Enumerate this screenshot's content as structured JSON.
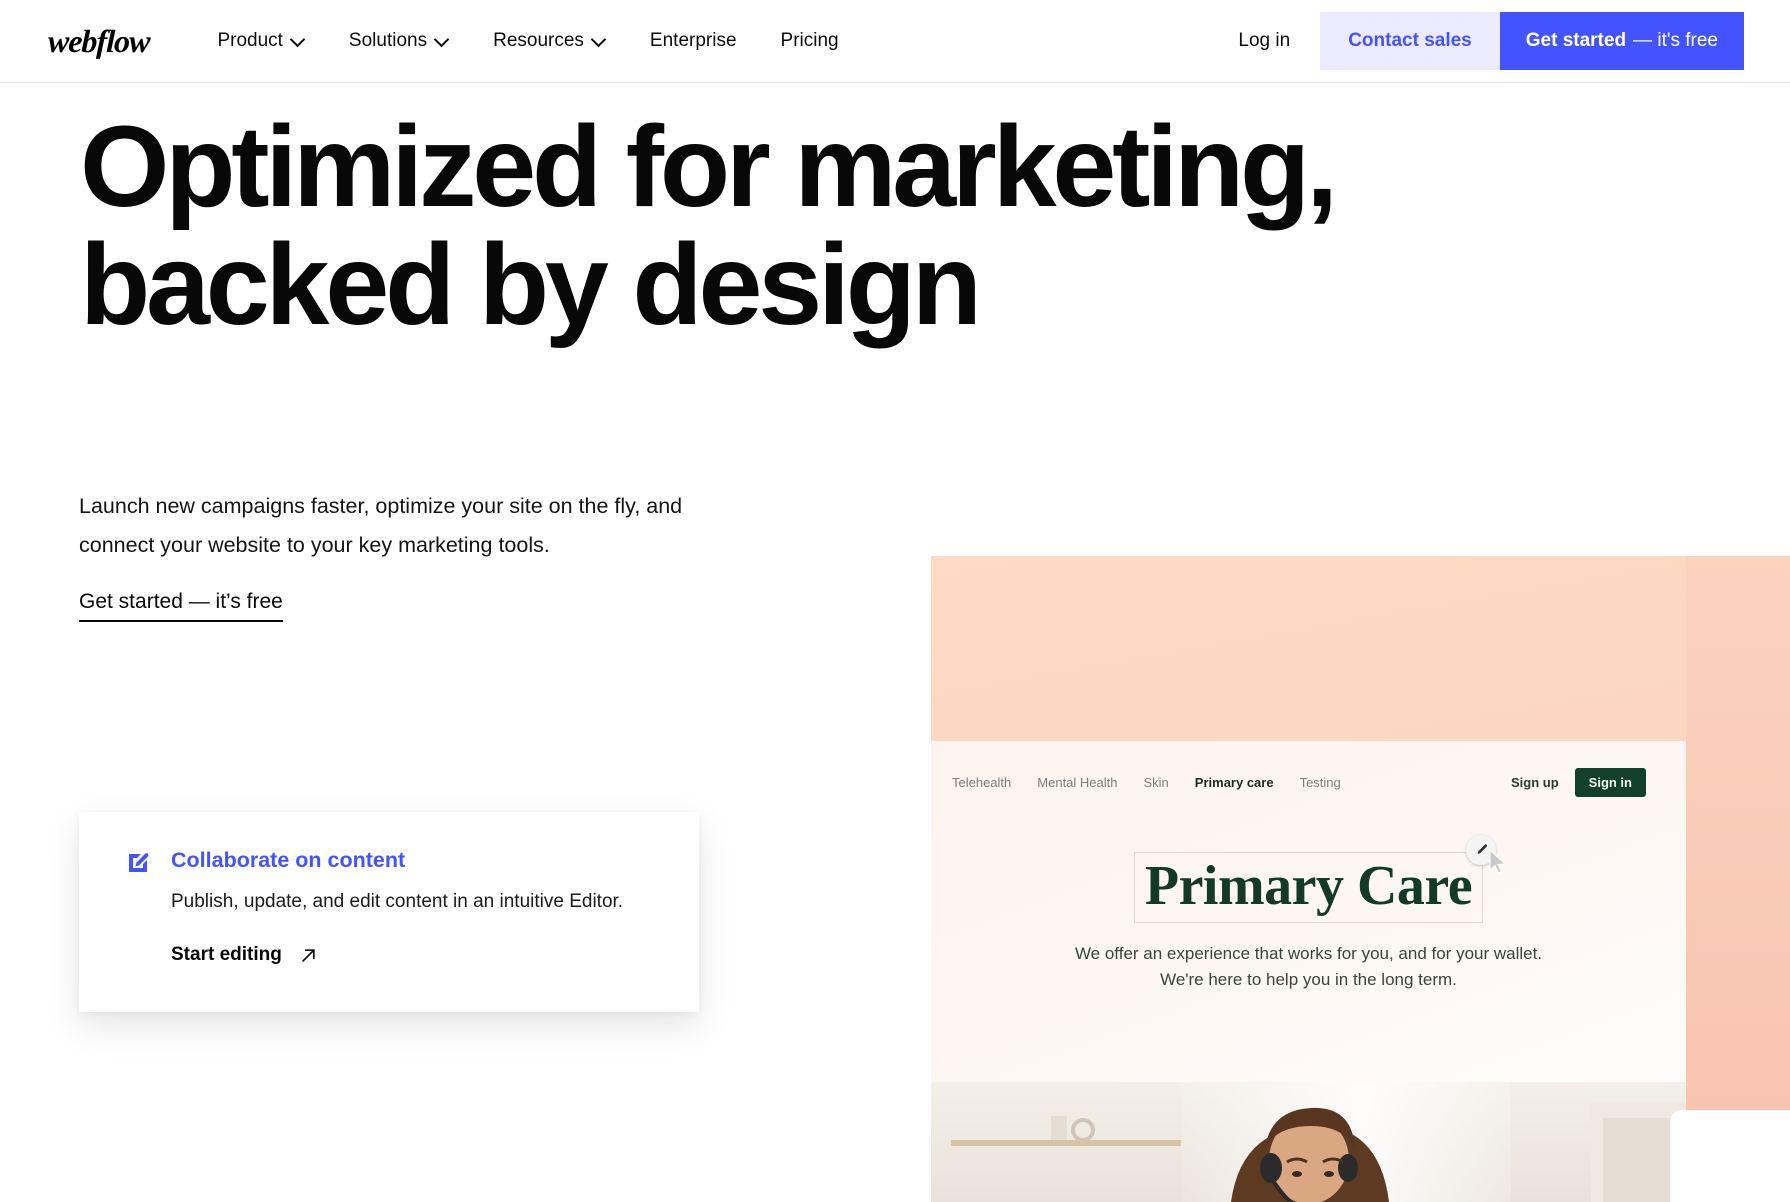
{
  "brand": {
    "name": "webflow"
  },
  "topnav": {
    "items": [
      {
        "label": "Product",
        "has_chevron": true
      },
      {
        "label": "Solutions",
        "has_chevron": true
      },
      {
        "label": "Resources",
        "has_chevron": true
      },
      {
        "label": "Enterprise",
        "has_chevron": false
      },
      {
        "label": "Pricing",
        "has_chevron": false
      }
    ],
    "login_label": "Log in",
    "contact_sales_label": "Contact sales",
    "get_started_bold": "Get started",
    "get_started_light": "— it's free",
    "accent_blue": "#4353ff",
    "contact_bg": "#ecebfd"
  },
  "hero": {
    "title_line1": "Optimized for marketing,",
    "title_line2": "backed by design",
    "lead": "Launch new campaigns faster, optimize your site on the fly, and connect your website to your key marketing tools.",
    "cta_label": "Get started — it’s free"
  },
  "card": {
    "icon": "edit-square-icon",
    "title": "Collaborate on content",
    "description": "Publish, update, and edit content in an intuitive Editor.",
    "cta_label": "Start editing",
    "cta_icon": "arrow-up-right-icon",
    "title_color": "#4353ff"
  },
  "mockup": {
    "background_gradient_from": "#fddbc4",
    "background_gradient_to": "#f9c3b1",
    "nav_items": [
      {
        "label": "Telehealth",
        "active": false
      },
      {
        "label": "Mental Health",
        "active": false
      },
      {
        "label": "Skin",
        "active": false
      },
      {
        "label": "Primary care",
        "active": true
      },
      {
        "label": "Testing",
        "active": false
      }
    ],
    "sign_up_label": "Sign up",
    "sign_in_label": "Sign in",
    "sign_in_bg": "#12402c",
    "heading": "Primary Care",
    "heading_color": "#123a25",
    "subtitle": "We offer an experience that works for you, and for your wallet. We're here to help you in the long term.",
    "cursor_icon": "pencil-cursor-badge",
    "photo_alt": "woman-with-headset-photo"
  }
}
